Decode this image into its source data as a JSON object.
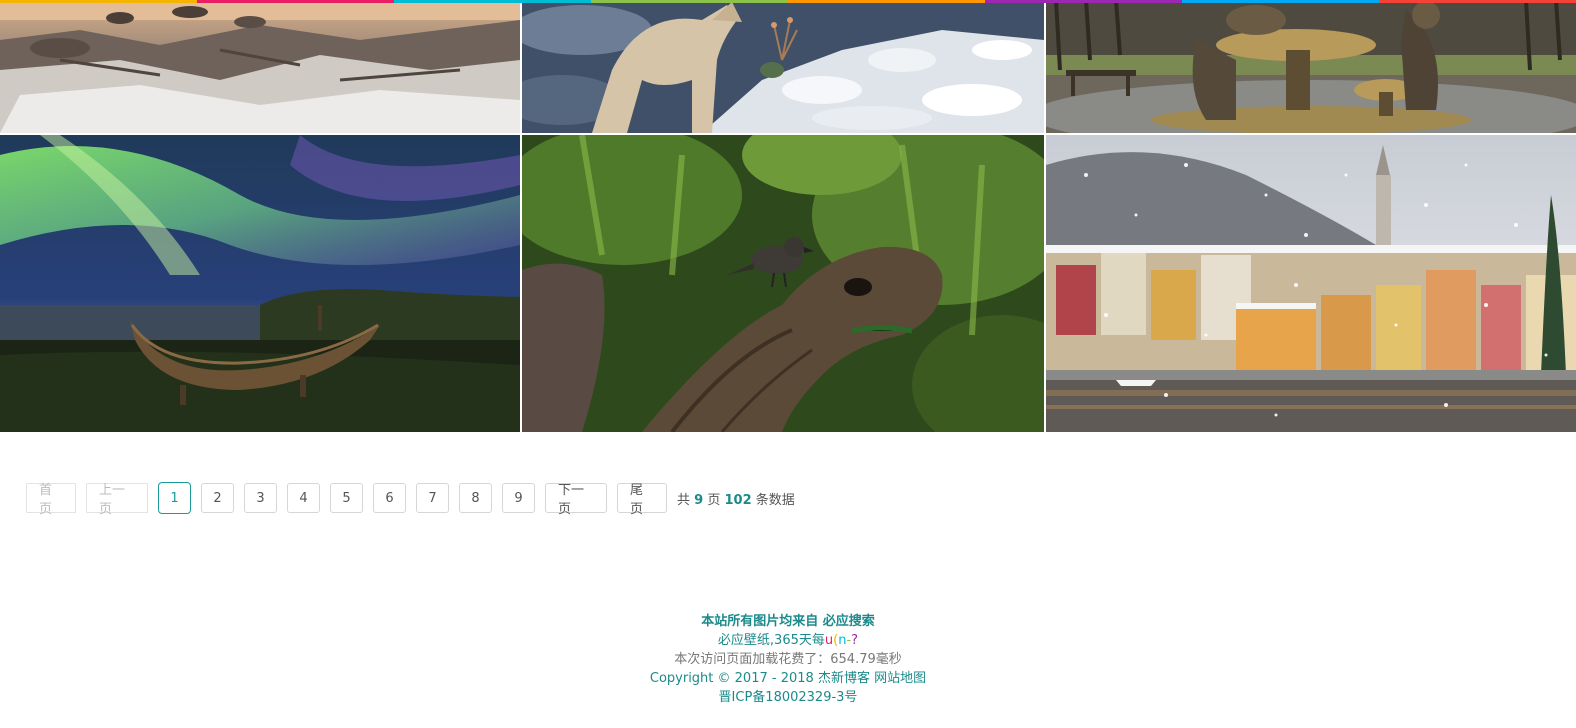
{
  "accent_colors": [
    "#f4b400",
    "#e91e63",
    "#00bcd4",
    "#8bc34a",
    "#ff9800",
    "#9c27b0",
    "#03a9f4",
    "#f44336"
  ],
  "gallery": {
    "images": [
      {
        "name": "rocky-shore-snow",
        "alt": "rocky shore"
      },
      {
        "name": "arctic-fox-snow",
        "alt": "fox in snow"
      },
      {
        "name": "alice-statue-park",
        "alt": "bronze statue in park"
      },
      {
        "name": "aurora-viking-boat",
        "alt": "aurora over boat"
      },
      {
        "name": "tortoise-finch",
        "alt": "tortoise with finch"
      },
      {
        "name": "lake-village-snow",
        "alt": "lakeside village in snow"
      }
    ]
  },
  "pagination": {
    "first": "首页",
    "prev": "上一页",
    "pages": [
      "1",
      "2",
      "3",
      "4",
      "5",
      "6",
      "7",
      "8",
      "9"
    ],
    "current": "1",
    "next": "下一页",
    "last": "尾页",
    "summary_prefix": "共",
    "total_pages": "9",
    "pages_word": "页",
    "total_items": "102",
    "items_word": "条数据"
  },
  "footer": {
    "source_line": "本站所有图片均来自 必应搜索",
    "tagline_text": "必应壁纸,365天每",
    "kaomoji": [
      "u",
      "(",
      "n",
      "-",
      "?"
    ],
    "kaomoji_colors": [
      "#e91e63",
      "#f4b400",
      "#00bcd4",
      "#8bc34a",
      "#9c27b0"
    ],
    "load_time": "本次访问页面加载花费了：654.79毫秒",
    "copyright_text": "Copyright © 2017 - 2018",
    "blog_link": "杰新博客",
    "sitemap_link": "网站地图",
    "icp": "晋ICP备18002329-3号"
  }
}
